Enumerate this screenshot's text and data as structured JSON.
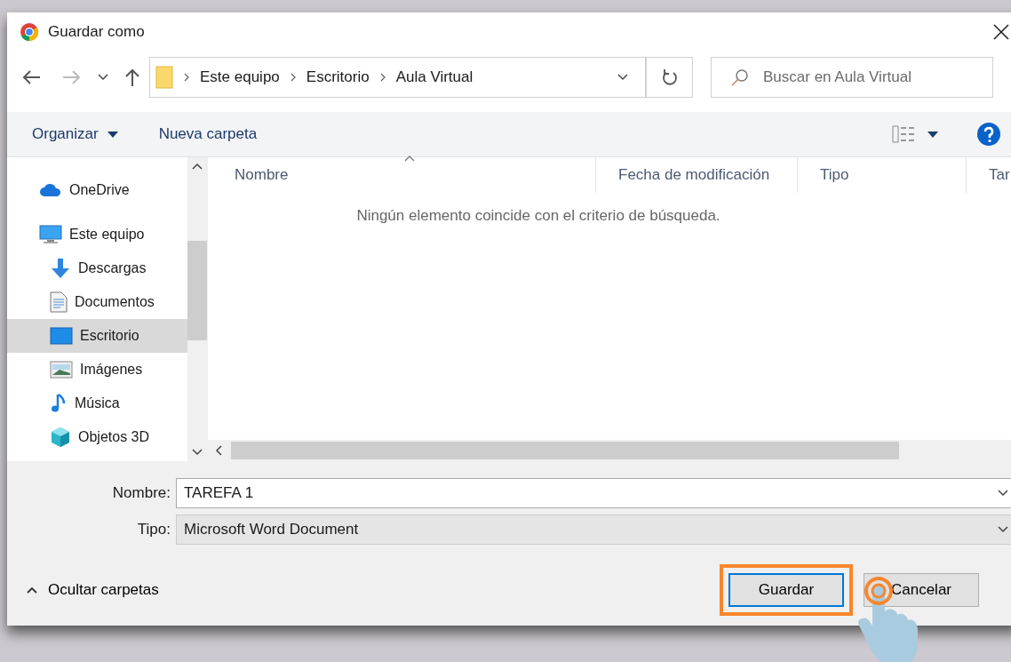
{
  "window": {
    "title": "Guardar como"
  },
  "address": {
    "path": [
      "Este equipo",
      "Escritorio",
      "Aula  Virtual"
    ]
  },
  "search": {
    "placeholder": "Buscar en Aula  Virtual"
  },
  "toolbar": {
    "organize": "Organizar",
    "new_folder": "Nueva carpeta"
  },
  "sidebar": {
    "items": [
      {
        "label": "OneDrive",
        "kind": "cloud",
        "selected": false
      },
      {
        "label": "Este equipo",
        "kind": "pc",
        "selected": false,
        "children": [
          {
            "label": "Descargas",
            "kind": "download",
            "selected": false
          },
          {
            "label": "Documentos",
            "kind": "documents",
            "selected": false
          },
          {
            "label": "Escritorio",
            "kind": "desktop",
            "selected": true
          },
          {
            "label": "Imágenes",
            "kind": "pictures",
            "selected": false
          },
          {
            "label": "Música",
            "kind": "music",
            "selected": false
          },
          {
            "label": "Objetos 3D",
            "kind": "objects",
            "selected": false
          }
        ]
      }
    ]
  },
  "table": {
    "columns": [
      {
        "label": "Nombre",
        "sorted": true
      },
      {
        "label": "Fecha de modificación",
        "sorted": false
      },
      {
        "label": "Tipo",
        "sorted": false
      },
      {
        "label": "Tar",
        "sorted": false
      }
    ],
    "empty_message": "Ningún elemento coincide con el criterio de búsqueda."
  },
  "form": {
    "name_label": "Nombre:",
    "name_value": "TAREFA 1",
    "type_label": "Tipo:",
    "type_value": "Microsoft Word Document"
  },
  "hide_folders": "Ocultar carpetas",
  "buttons": [
    {
      "label": "Guardar",
      "highlighted": true
    },
    {
      "label": "Cancelar",
      "highlighted": false
    }
  ]
}
